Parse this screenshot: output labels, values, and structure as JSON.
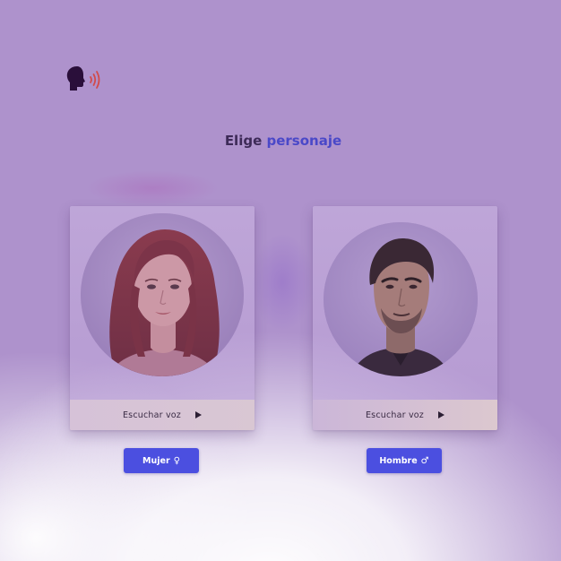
{
  "header": {
    "logo_icon": "speaking-head-icon",
    "title_prefix": "Elige",
    "title_accent": "personaje"
  },
  "characters": [
    {
      "id": "mujer",
      "portrait_icon": "woman-portrait-icon",
      "listen_label": "Escuchar voz",
      "play_icon": "play-icon",
      "button_label": "Mujer",
      "gender_symbol": "♀"
    },
    {
      "id": "hombre",
      "portrait_icon": "man-portrait-icon",
      "listen_label": "Escuchar voz",
      "play_icon": "play-icon",
      "button_label": "Hombre",
      "gender_symbol": "♂"
    }
  ],
  "colors": {
    "background": "#ae92cc",
    "title": "#3d2a57",
    "title_accent": "#4a48c8",
    "button": "#4b4fe0",
    "listen_bar": "#d6c2d8"
  }
}
